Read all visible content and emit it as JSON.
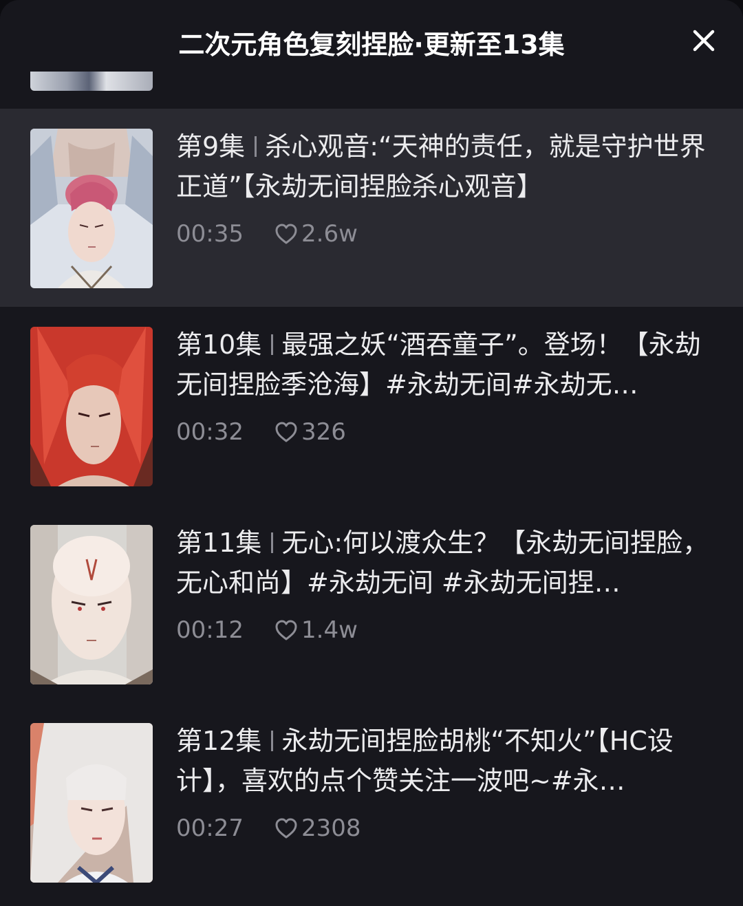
{
  "header": {
    "title": "二次元角色复刻捏脸·更新至13集",
    "close_icon": "close-icon"
  },
  "episodes": [
    {
      "episode": "第9集",
      "title": "杀心观音:“天神的责任，就是守护世界正道”【永劫无间捏脸杀心观音】",
      "duration": "00:35",
      "likes": "2.6w",
      "active": true
    },
    {
      "episode": "第10集",
      "title": "最强之妖“酒吞童子”。登场！【永劫无间捏脸季沧海】#永劫无间#永劫无…",
      "duration": "00:32",
      "likes": "326",
      "active": false
    },
    {
      "episode": "第11集",
      "title": "无心:何以渡众生？【永劫无间捏脸，无心和尚】#永劫无间 #永劫无间捏…",
      "duration": "00:12",
      "likes": "1.4w",
      "active": false
    },
    {
      "episode": "第12集",
      "title": "永劫无间捏脸胡桃“不知火”【HC设计】，喜欢的点个赞关注一波吧~#永…",
      "duration": "00:27",
      "likes": "2308",
      "active": false
    }
  ]
}
